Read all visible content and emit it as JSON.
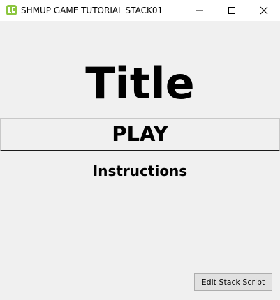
{
  "window": {
    "title": "SHMUP GAME TUTORIAL STACK01",
    "icon": "livecode-app-icon",
    "controls": {
      "minimize_icon": "minimize-icon",
      "maximize_icon": "maximize-icon",
      "close_icon": "close-icon"
    }
  },
  "stage": {
    "title": "Title",
    "play_label": "PLAY",
    "instructions_label": "Instructions",
    "edit_button_label": "Edit Stack Script"
  },
  "colors": {
    "background": "#f0f0f0",
    "titlebar": "#ffffff",
    "app_icon": "#8cc63f",
    "text": "#000000"
  }
}
